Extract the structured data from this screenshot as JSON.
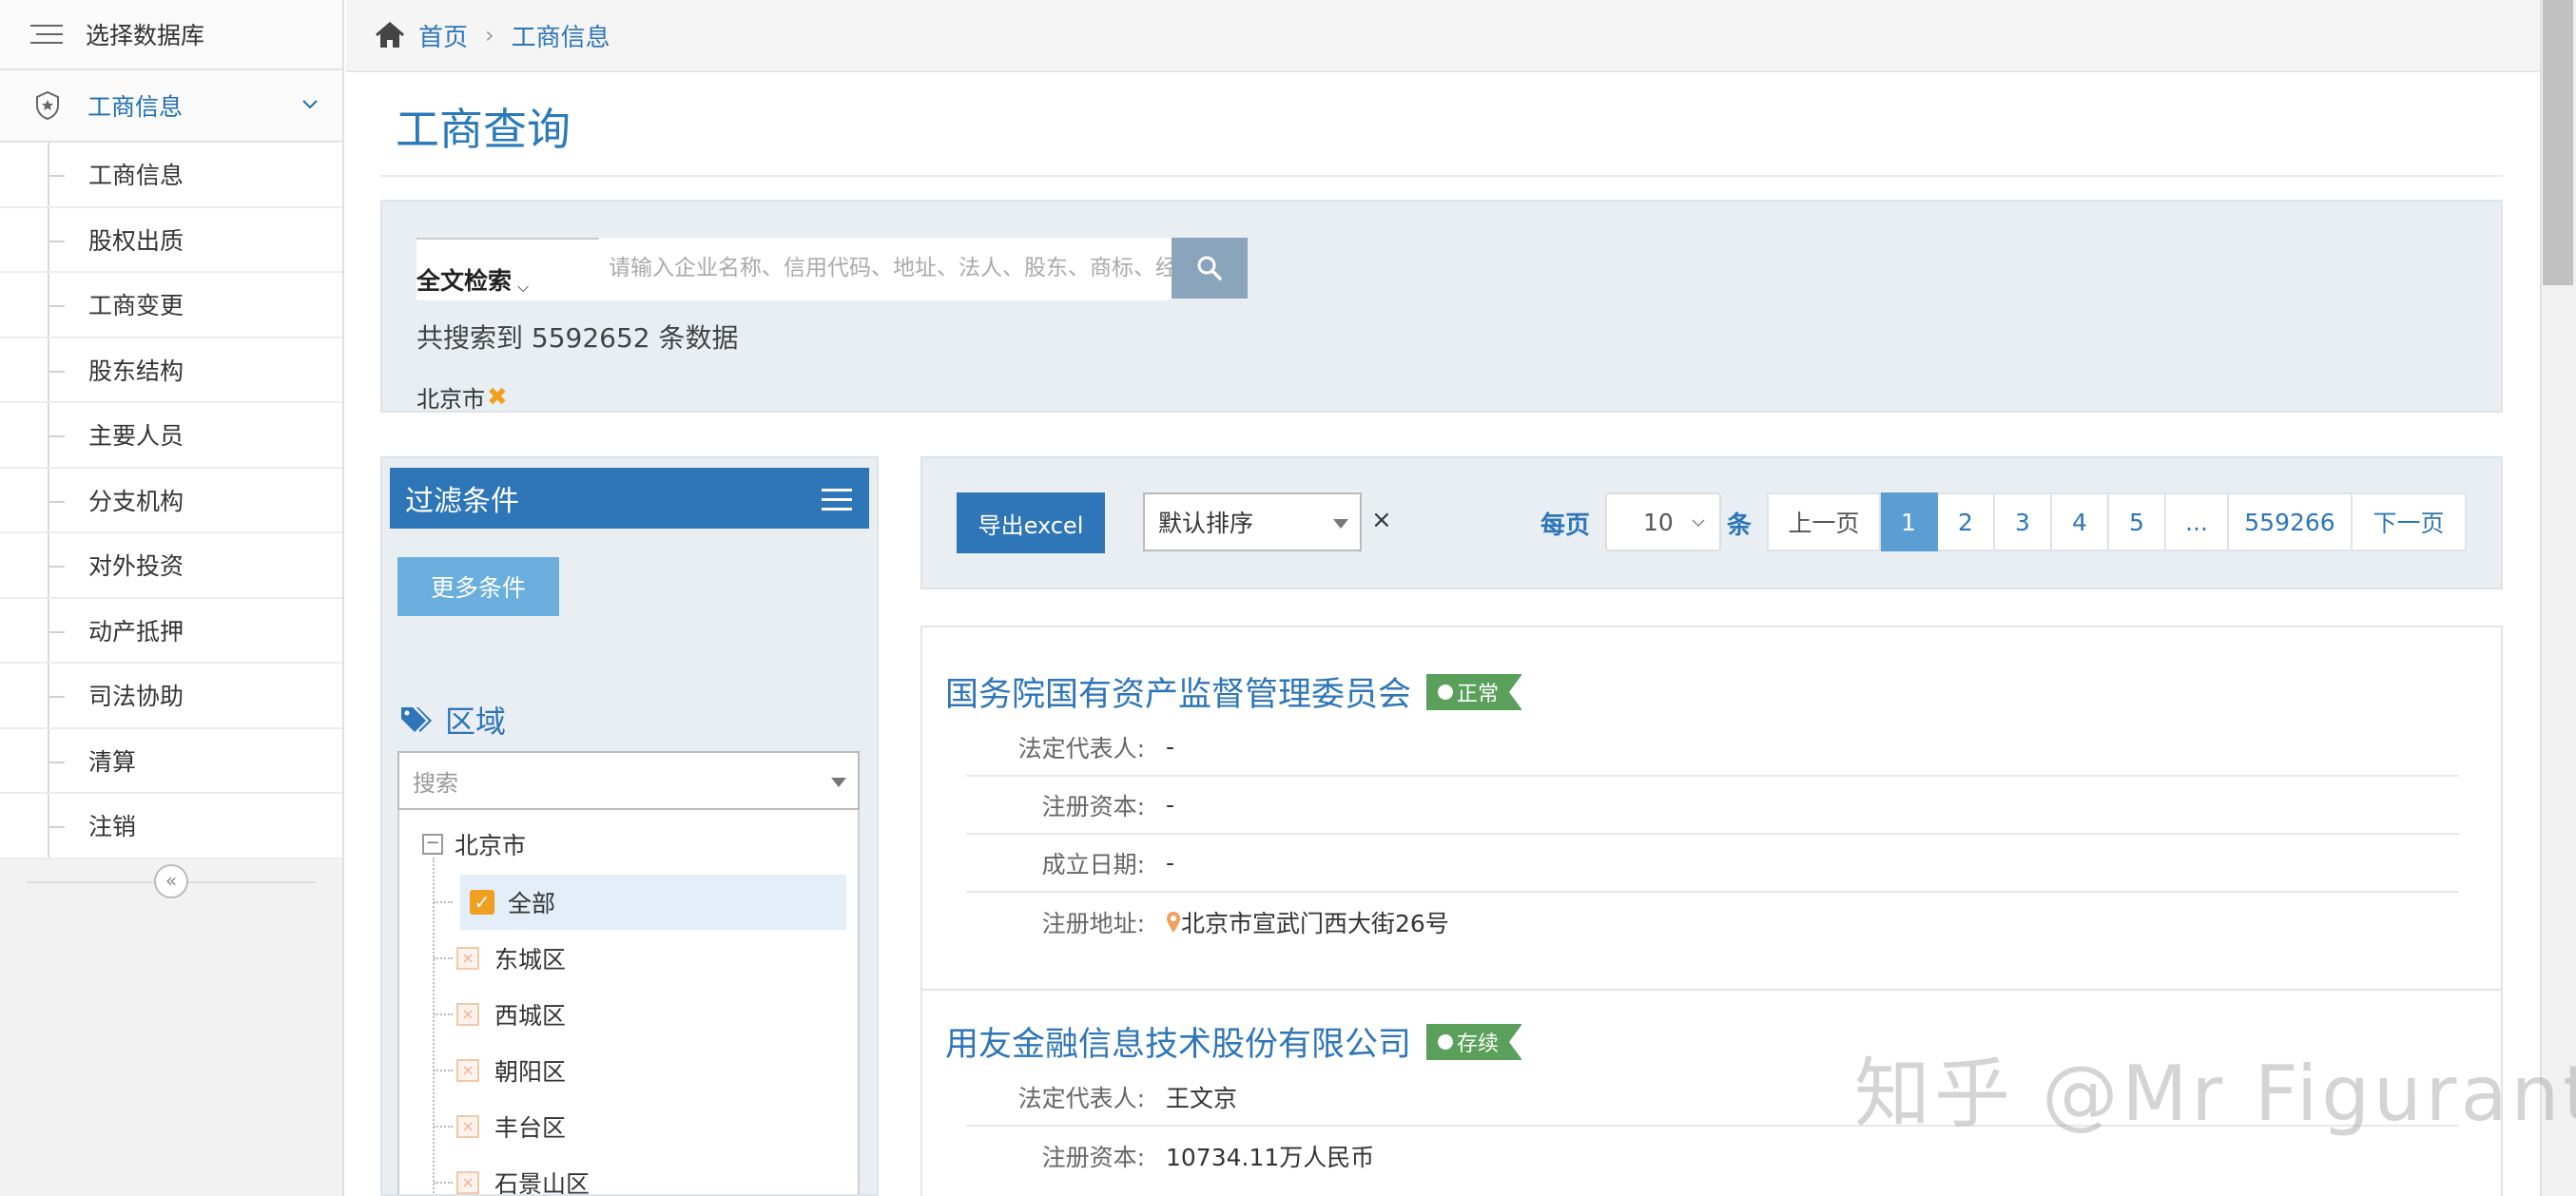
{
  "sidebar": {
    "db_label": "选择数据库",
    "group_label": "工商信息",
    "items": [
      "工商信息",
      "股权出质",
      "工商变更",
      "股东结构",
      "主要人员",
      "分支机构",
      "对外投资",
      "动产抵押",
      "司法协助",
      "清算",
      "注销"
    ],
    "collapse_glyph": "«"
  },
  "breadcrumb": {
    "home": "首页",
    "separator": "›",
    "current": "工商信息"
  },
  "page": {
    "title": "工商查询"
  },
  "search": {
    "mode_label": "全文检索",
    "placeholder": "请输入企业名称、信用代码、地址、法人、股东、商标、经营范围",
    "count_text": "共搜索到 5592652 条数据",
    "active_tag": "北京市",
    "tag_remove": "✖"
  },
  "filter": {
    "header": "过滤条件",
    "more_button": "更多条件",
    "region_label": "区域",
    "search_placeholder": "搜索",
    "tree_root": "北京市",
    "tree_items": [
      {
        "label": "全部",
        "checked": true
      },
      {
        "label": "东城区",
        "checked": false
      },
      {
        "label": "西城区",
        "checked": false
      },
      {
        "label": "朝阳区",
        "checked": false
      },
      {
        "label": "丰台区",
        "checked": false
      },
      {
        "label": "石景山区",
        "checked": false
      }
    ]
  },
  "toolbar": {
    "export_label": "导出excel",
    "sort_value": "默认排序",
    "clear_glyph": "×",
    "per_page_label": "每页",
    "page_size": "10",
    "unit_label": "条",
    "pager": [
      "上一页",
      "1",
      "2",
      "3",
      "4",
      "5",
      "...",
      "559266",
      "下一页"
    ],
    "active_page": "1"
  },
  "results": [
    {
      "name": "国务院国有资产监督管理委员会",
      "status": "正常",
      "fields": [
        {
          "label": "法定代表人:",
          "value": "-"
        },
        {
          "label": "注册资本:",
          "value": "-"
        },
        {
          "label": "成立日期:",
          "value": "-"
        },
        {
          "label": "注册地址:",
          "value": "北京市宣武门西大街26号"
        }
      ]
    },
    {
      "name": "用友金融信息技术股份有限公司",
      "status": "存续",
      "fields": [
        {
          "label": "法定代表人:",
          "value": "王文京"
        },
        {
          "label": "注册资本:",
          "value": "10734.11万人民币"
        }
      ]
    }
  ],
  "watermark": "知乎 @Mr Figurant",
  "colors": {
    "accent": "#2e76b7",
    "badge": "#5aa05a",
    "check": "#f0a020",
    "panel": "#e8eef2"
  }
}
